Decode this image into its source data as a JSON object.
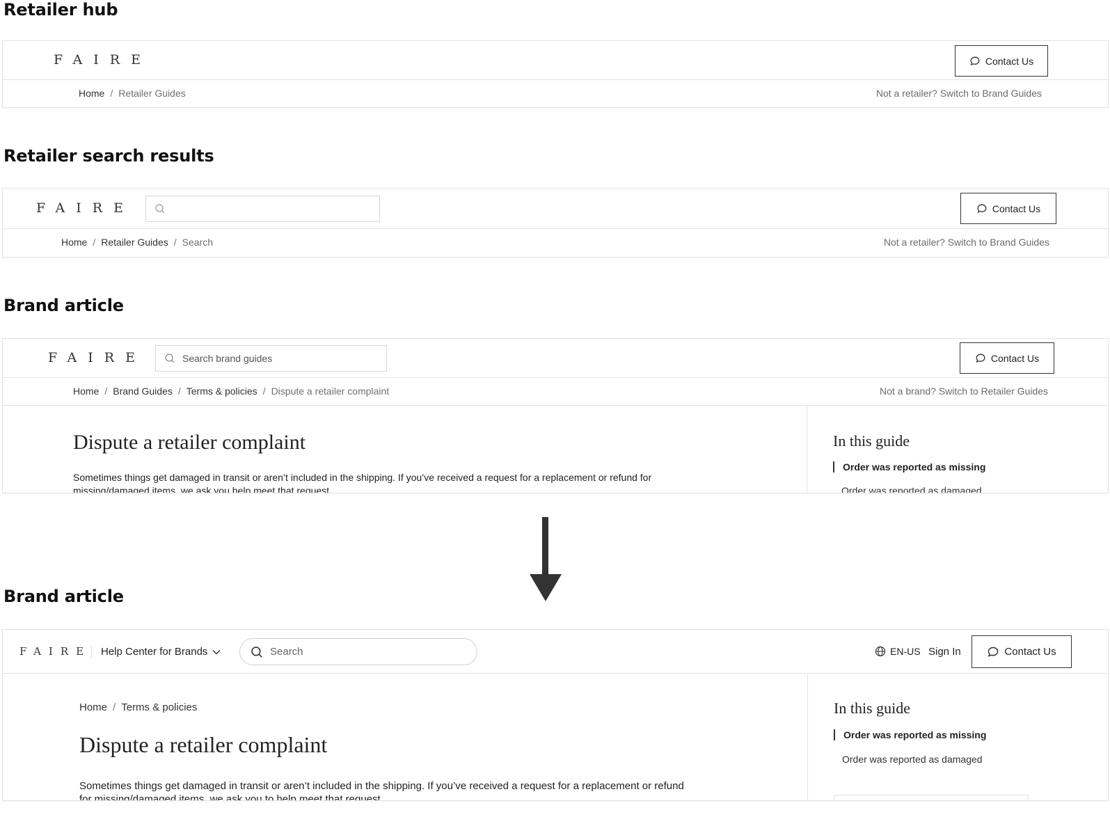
{
  "sections": {
    "retailer_hub": "Retailer hub",
    "retailer_search": "Retailer search results",
    "brand_article_old": "Brand article",
    "brand_article_new": "Brand article"
  },
  "logo_text": "FAIRE",
  "contact_label": "Contact Us",
  "panel1": {
    "crumbs": [
      "Home",
      "Retailer Guides"
    ],
    "switch": "Not a retailer? Switch to Brand Guides"
  },
  "panel2": {
    "search_placeholder": "",
    "crumbs": [
      "Home",
      "Retailer Guides",
      "Search"
    ],
    "switch": "Not a retailer? Switch to Brand Guides"
  },
  "panel3": {
    "search_placeholder": "Search brand guides",
    "crumbs": [
      "Home",
      "Brand Guides",
      "Terms & policies",
      "Dispute a retailer complaint"
    ],
    "switch": "Not a brand? Switch to Retailer Guides",
    "title": "Dispute a retailer complaint",
    "body": "Sometimes things get damaged in transit or aren’t included in the shipping. If you’ve received a request for a replacement or refund for missing/damaged items, we ask you help meet that request.",
    "toc_title": "In this guide",
    "toc": [
      "Order was reported as missing",
      "Order was reported as damaged"
    ]
  },
  "panel4": {
    "help_center": "Help Center for Brands",
    "search_placeholder": "Search",
    "locale": "EN-US",
    "sign_in": "Sign In",
    "crumbs": [
      "Home",
      "Terms & policies"
    ],
    "title": "Dispute a retailer complaint",
    "body": "Sometimes things get damaged in transit or aren’t included in the shipping. If you’ve received a request for a replacement or refund for missing/damaged items, we ask you to help meet that request.",
    "toc_title": "In this guide",
    "toc": [
      "Order was reported as missing",
      "Order was reported as damaged"
    ]
  },
  "icons": [
    "chat-bubble-icon",
    "search-icon",
    "globe-icon",
    "chevron-down-icon",
    "arrow-down-icon"
  ]
}
